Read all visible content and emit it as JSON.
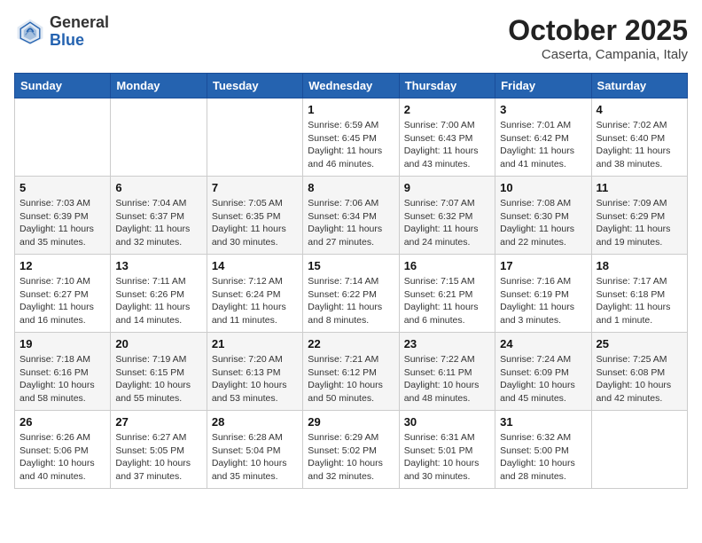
{
  "header": {
    "logo_general": "General",
    "logo_blue": "Blue",
    "month": "October 2025",
    "location": "Caserta, Campania, Italy"
  },
  "weekdays": [
    "Sunday",
    "Monday",
    "Tuesday",
    "Wednesday",
    "Thursday",
    "Friday",
    "Saturday"
  ],
  "weeks": [
    [
      {
        "day": "",
        "sunrise": "",
        "sunset": "",
        "daylight": ""
      },
      {
        "day": "",
        "sunrise": "",
        "sunset": "",
        "daylight": ""
      },
      {
        "day": "",
        "sunrise": "",
        "sunset": "",
        "daylight": ""
      },
      {
        "day": "1",
        "sunrise": "6:59 AM",
        "sunset": "6:45 PM",
        "daylight": "11 hours and 46 minutes."
      },
      {
        "day": "2",
        "sunrise": "7:00 AM",
        "sunset": "6:43 PM",
        "daylight": "11 hours and 43 minutes."
      },
      {
        "day": "3",
        "sunrise": "7:01 AM",
        "sunset": "6:42 PM",
        "daylight": "11 hours and 41 minutes."
      },
      {
        "day": "4",
        "sunrise": "7:02 AM",
        "sunset": "6:40 PM",
        "daylight": "11 hours and 38 minutes."
      }
    ],
    [
      {
        "day": "5",
        "sunrise": "7:03 AM",
        "sunset": "6:39 PM",
        "daylight": "11 hours and 35 minutes."
      },
      {
        "day": "6",
        "sunrise": "7:04 AM",
        "sunset": "6:37 PM",
        "daylight": "11 hours and 32 minutes."
      },
      {
        "day": "7",
        "sunrise": "7:05 AM",
        "sunset": "6:35 PM",
        "daylight": "11 hours and 30 minutes."
      },
      {
        "day": "8",
        "sunrise": "7:06 AM",
        "sunset": "6:34 PM",
        "daylight": "11 hours and 27 minutes."
      },
      {
        "day": "9",
        "sunrise": "7:07 AM",
        "sunset": "6:32 PM",
        "daylight": "11 hours and 24 minutes."
      },
      {
        "day": "10",
        "sunrise": "7:08 AM",
        "sunset": "6:30 PM",
        "daylight": "11 hours and 22 minutes."
      },
      {
        "day": "11",
        "sunrise": "7:09 AM",
        "sunset": "6:29 PM",
        "daylight": "11 hours and 19 minutes."
      }
    ],
    [
      {
        "day": "12",
        "sunrise": "7:10 AM",
        "sunset": "6:27 PM",
        "daylight": "11 hours and 16 minutes."
      },
      {
        "day": "13",
        "sunrise": "7:11 AM",
        "sunset": "6:26 PM",
        "daylight": "11 hours and 14 minutes."
      },
      {
        "day": "14",
        "sunrise": "7:12 AM",
        "sunset": "6:24 PM",
        "daylight": "11 hours and 11 minutes."
      },
      {
        "day": "15",
        "sunrise": "7:14 AM",
        "sunset": "6:22 PM",
        "daylight": "11 hours and 8 minutes."
      },
      {
        "day": "16",
        "sunrise": "7:15 AM",
        "sunset": "6:21 PM",
        "daylight": "11 hours and 6 minutes."
      },
      {
        "day": "17",
        "sunrise": "7:16 AM",
        "sunset": "6:19 PM",
        "daylight": "11 hours and 3 minutes."
      },
      {
        "day": "18",
        "sunrise": "7:17 AM",
        "sunset": "6:18 PM",
        "daylight": "11 hours and 1 minute."
      }
    ],
    [
      {
        "day": "19",
        "sunrise": "7:18 AM",
        "sunset": "6:16 PM",
        "daylight": "10 hours and 58 minutes."
      },
      {
        "day": "20",
        "sunrise": "7:19 AM",
        "sunset": "6:15 PM",
        "daylight": "10 hours and 55 minutes."
      },
      {
        "day": "21",
        "sunrise": "7:20 AM",
        "sunset": "6:13 PM",
        "daylight": "10 hours and 53 minutes."
      },
      {
        "day": "22",
        "sunrise": "7:21 AM",
        "sunset": "6:12 PM",
        "daylight": "10 hours and 50 minutes."
      },
      {
        "day": "23",
        "sunrise": "7:22 AM",
        "sunset": "6:11 PM",
        "daylight": "10 hours and 48 minutes."
      },
      {
        "day": "24",
        "sunrise": "7:24 AM",
        "sunset": "6:09 PM",
        "daylight": "10 hours and 45 minutes."
      },
      {
        "day": "25",
        "sunrise": "7:25 AM",
        "sunset": "6:08 PM",
        "daylight": "10 hours and 42 minutes."
      }
    ],
    [
      {
        "day": "26",
        "sunrise": "6:26 AM",
        "sunset": "5:06 PM",
        "daylight": "10 hours and 40 minutes."
      },
      {
        "day": "27",
        "sunrise": "6:27 AM",
        "sunset": "5:05 PM",
        "daylight": "10 hours and 37 minutes."
      },
      {
        "day": "28",
        "sunrise": "6:28 AM",
        "sunset": "5:04 PM",
        "daylight": "10 hours and 35 minutes."
      },
      {
        "day": "29",
        "sunrise": "6:29 AM",
        "sunset": "5:02 PM",
        "daylight": "10 hours and 32 minutes."
      },
      {
        "day": "30",
        "sunrise": "6:31 AM",
        "sunset": "5:01 PM",
        "daylight": "10 hours and 30 minutes."
      },
      {
        "day": "31",
        "sunrise": "6:32 AM",
        "sunset": "5:00 PM",
        "daylight": "10 hours and 28 minutes."
      },
      {
        "day": "",
        "sunrise": "",
        "sunset": "",
        "daylight": ""
      }
    ]
  ]
}
